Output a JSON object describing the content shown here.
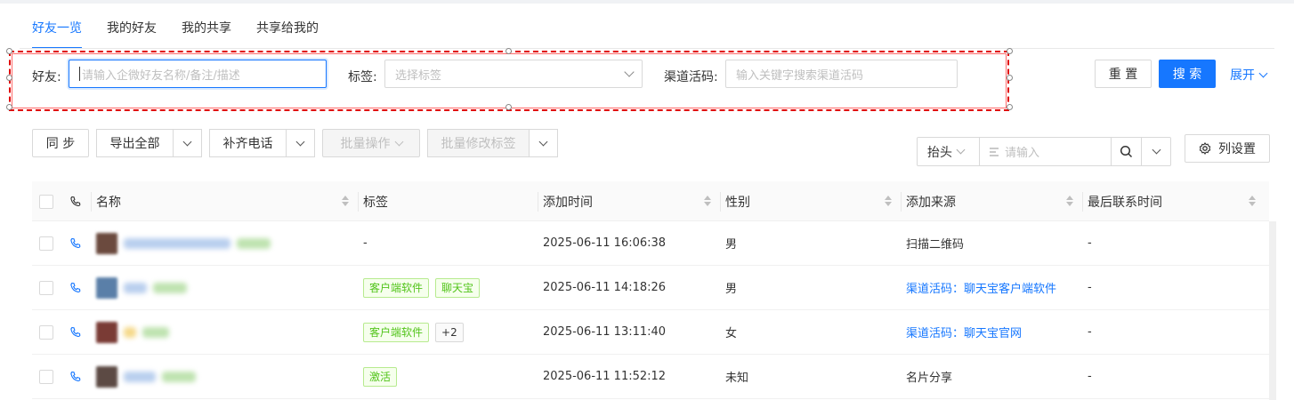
{
  "tabs": [
    {
      "label": "好友一览",
      "active": true
    },
    {
      "label": "我的好友",
      "active": false
    },
    {
      "label": "我的共享",
      "active": false
    },
    {
      "label": "共享给我的",
      "active": false
    }
  ],
  "filters": {
    "friend_label": "好友:",
    "friend_placeholder": "请输入企微好友名称/备注/描述",
    "tag_label": "标签:",
    "tag_placeholder": "选择标签",
    "channel_label": "渠道活码:",
    "channel_placeholder": "输入关键字搜索渠道活码",
    "reset": "重 置",
    "search": "搜 索",
    "expand": "展开"
  },
  "toolbar": {
    "sync": "同 步",
    "export_all": "导出全部",
    "fill_phone": "补齐电话",
    "batch_ops": "批量操作",
    "batch_edit_tags": "批量修改标签",
    "search_field": "抬头",
    "search_placeholder": "请输入",
    "column_settings": "列设置"
  },
  "table": {
    "headers": [
      "名称",
      "标签",
      "添加时间",
      "性别",
      "添加来源",
      "最后联系时间"
    ],
    "rows": [
      {
        "tags": [],
        "tag_text": "-",
        "time": "2025-06-11 16:06:38",
        "gender": "男",
        "source": "扫描二维码",
        "source_link": false,
        "last_contact": "-"
      },
      {
        "tags": [
          "客户端软件",
          "聊天宝"
        ],
        "tag_text": "",
        "time": "2025-06-11 14:18:26",
        "gender": "男",
        "source": "渠道活码：聊天宝客户端软件",
        "source_link": true,
        "last_contact": "-"
      },
      {
        "tags": [
          "客户端软件"
        ],
        "more": "+2",
        "tag_text": "",
        "time": "2025-06-11 13:11:40",
        "gender": "女",
        "source": "渠道活码：聊天宝官网",
        "source_link": true,
        "last_contact": "-"
      },
      {
        "tags": [
          "激活"
        ],
        "tag_text": "",
        "time": "2025-06-11 11:52:12",
        "gender": "未知",
        "source": "名片分享",
        "source_link": false,
        "last_contact": "-"
      }
    ]
  },
  "colors": {
    "primary": "#1677ff",
    "tag_green": "#52c41a",
    "selection_outline": "#e00000"
  }
}
